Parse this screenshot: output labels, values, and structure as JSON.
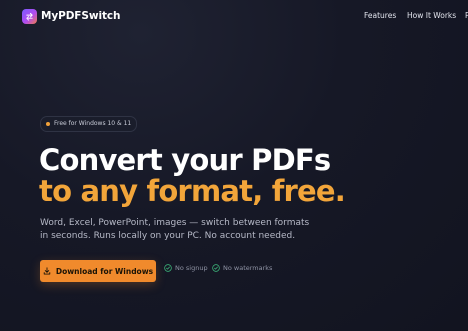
{
  "nav": {
    "brand": "MyPDFSwitch",
    "logo_icon": "swap-arrows-icon",
    "links": [
      "Features",
      "How It Works",
      "P"
    ]
  },
  "hero": {
    "badge": "Free for Windows 10 & 11",
    "headline_line1": "Convert your PDFs",
    "headline_line2": "to any format, free.",
    "subtitle": "Word, Excel, PowerPoint, images — switch between formats in seconds. Runs locally on your PC. No account needed.",
    "cta_label": "Download for Windows",
    "features": [
      "No signup",
      "No watermarks"
    ]
  },
  "colors": {
    "background": "#161826",
    "accent": "#f08a2c",
    "headline_accent": "#f2a53a",
    "check": "#3fbf7f",
    "logo_gradient": [
      "#7b5cff",
      "#f07a4a"
    ]
  }
}
